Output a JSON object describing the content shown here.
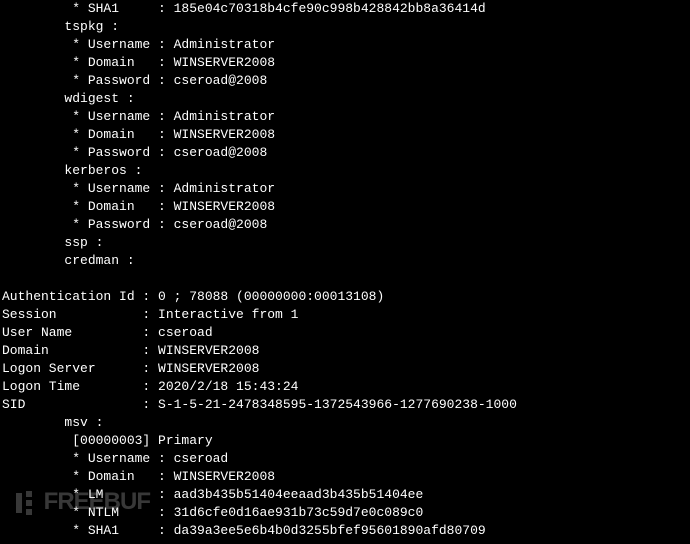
{
  "session1": {
    "sha1": "         * SHA1     : 185e04c70318b4cfe90c998b428842bb8a36414d",
    "tspkg": "        tspkg :",
    "t_user": "         * Username : Administrator",
    "t_domain": "         * Domain   : WINSERVER2008",
    "t_pass": "         * Password : cseroad@2008",
    "wdigest": "        wdigest :",
    "w_user": "         * Username : Administrator",
    "w_domain": "         * Domain   : WINSERVER2008",
    "w_pass": "         * Password : cseroad@2008",
    "kerberos": "        kerberos :",
    "k_user": "         * Username : Administrator",
    "k_domain": "         * Domain   : WINSERVER2008",
    "k_pass": "         * Password : cseroad@2008",
    "ssp": "        ssp :",
    "credman": "        credman :"
  },
  "blank": "",
  "session2": {
    "authid": "Authentication Id : 0 ; 78088 (00000000:00013108)",
    "session": "Session           : Interactive from 1",
    "username": "User Name         : cseroad",
    "domain": "Domain            : WINSERVER2008",
    "logonserver": "Logon Server      : WINSERVER2008",
    "logontime": "Logon Time        : 2020/2/18 15:43:24",
    "sid": "SID               : S-1-5-21-2478348595-1372543966-1277690238-1000",
    "msv": "        msv :",
    "primary": "         [00000003] Primary",
    "m_user": "         * Username : cseroad",
    "m_domain": "         * Domain   : WINSERVER2008",
    "m_lm": "         * LM       : aad3b435b51404eeaad3b435b51404ee",
    "m_ntlm": "         * NTLM     : 31d6cfe0d16ae931b73c59d7e0c089c0",
    "m_sha1": "         * SHA1     : da39a3ee5e6b4b0d3255bfef95601890afd80709"
  },
  "watermark": "FREEBUF"
}
